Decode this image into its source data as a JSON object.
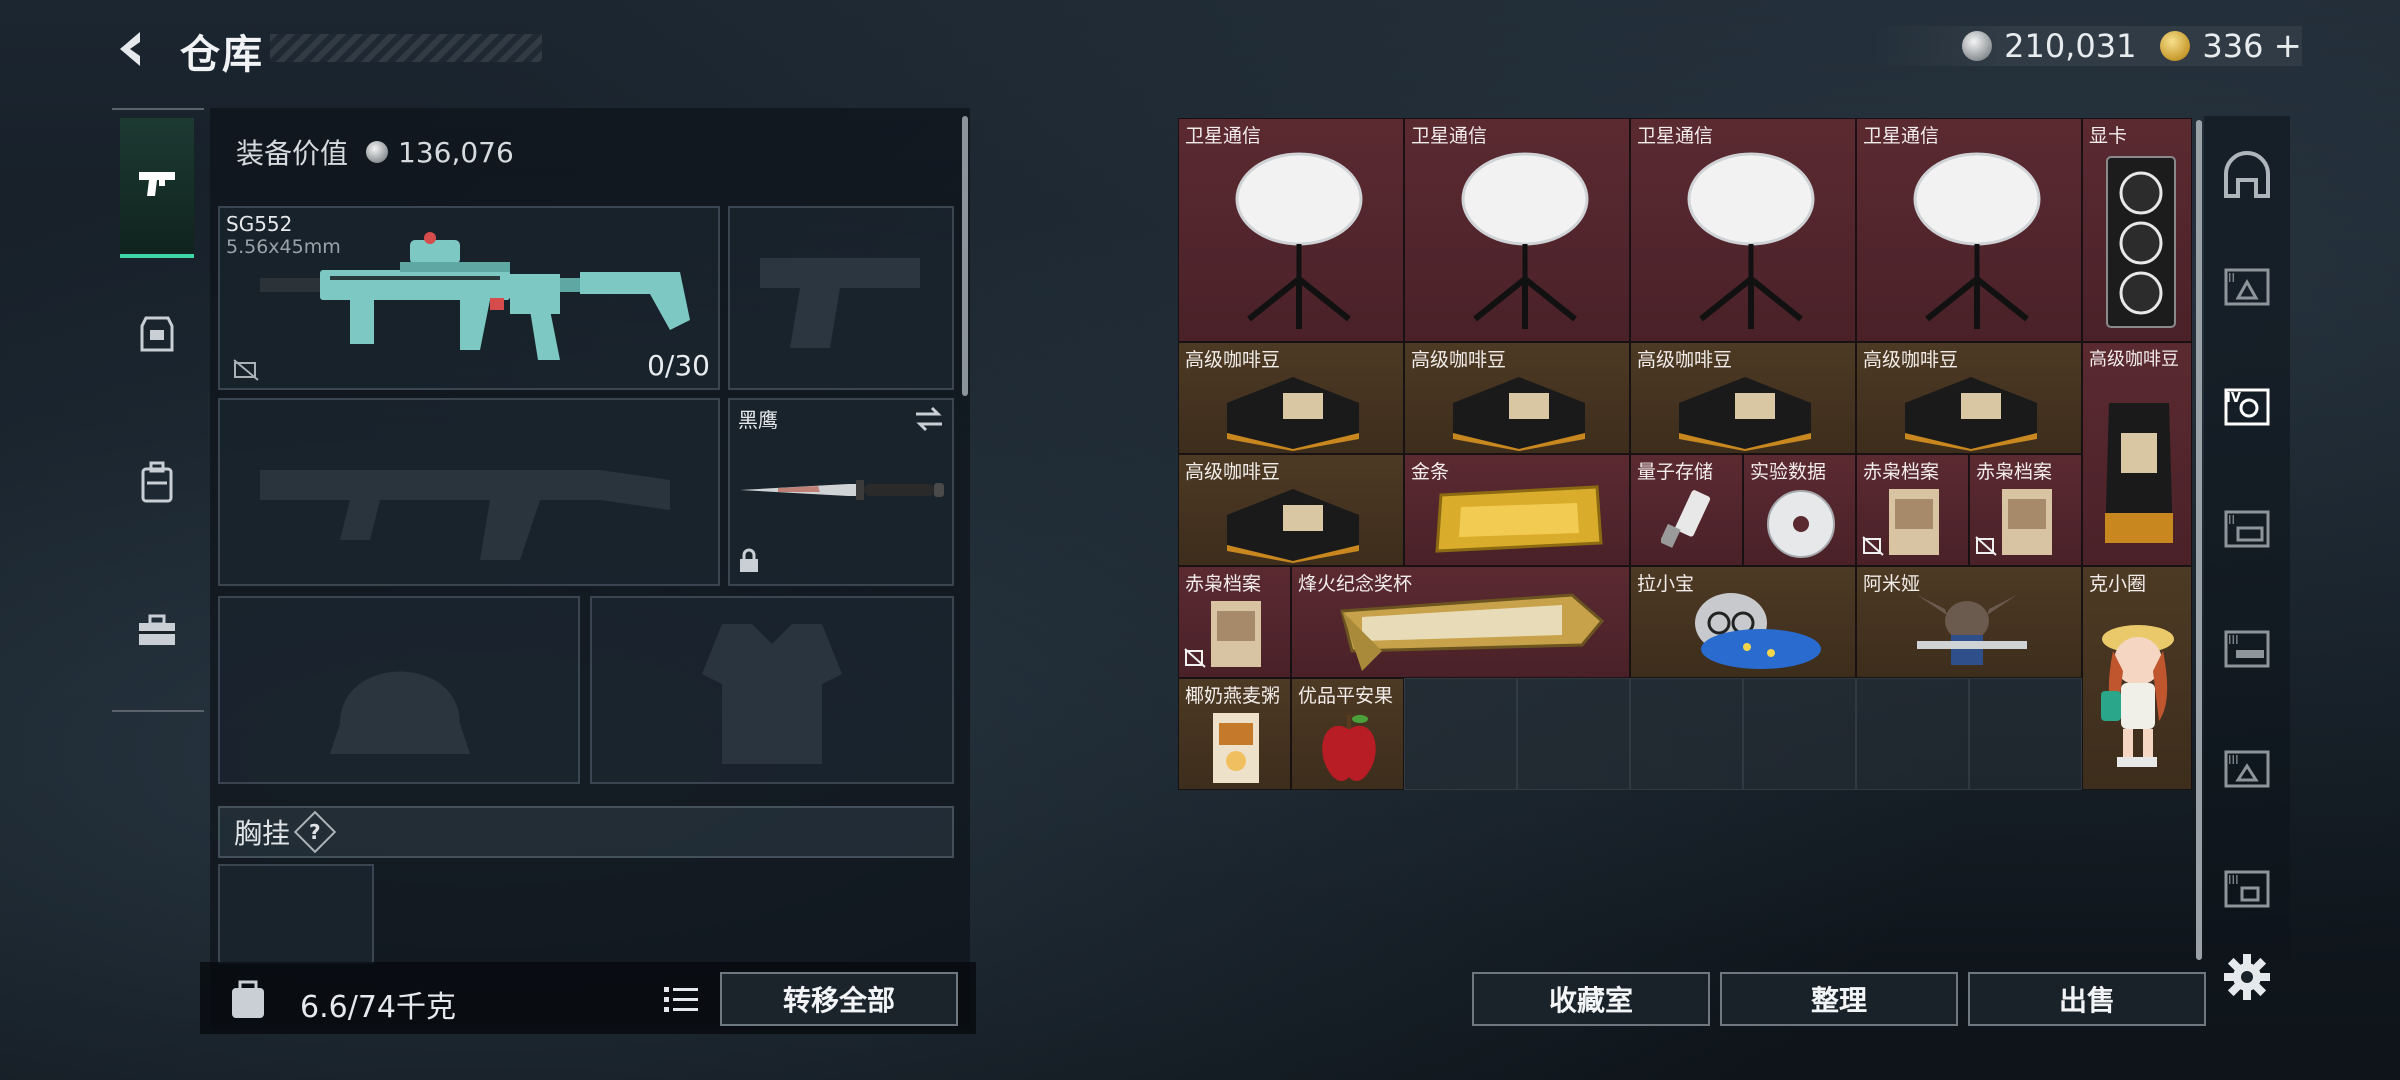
{
  "header": {
    "title": "仓库"
  },
  "currency": {
    "silver": "210,031",
    "gold": "336"
  },
  "loadout": {
    "equip_value_label": "装备价值",
    "equip_value": "136,076",
    "primary": {
      "name": "SG552",
      "caliber": "5.56x45mm",
      "ammo": "0/30"
    },
    "melee": {
      "name": "黑鹰"
    },
    "chest_rig_label": "胸挂",
    "weight": "6.6/74千克",
    "transfer_all": "转移全部"
  },
  "stash": {
    "items": [
      "卫星通信",
      "卫星通信",
      "卫星通信",
      "卫星通信",
      "显卡",
      "高级咖啡豆",
      "高级咖啡豆",
      "高级咖啡豆",
      "高级咖啡豆",
      "高级咖啡豆",
      "高级咖啡豆",
      "金条",
      "量子存储",
      "实验数据",
      "赤枭档案",
      "赤枭档案",
      "赤枭档案",
      "烽火纪念奖杯",
      "拉小宝",
      "阿米娅",
      "克小圈",
      "椰奶燕麦粥",
      "优品平安果"
    ]
  },
  "actions": {
    "collection": "收藏室",
    "organize": "整理",
    "sell": "出售"
  },
  "icons": [
    "back-arrow-icon",
    "silver-coin-icon",
    "gold-coin-icon",
    "pistol-icon",
    "armor-icon",
    "backpack-icon",
    "toolbox-icon",
    "settings-icon",
    "list-icon",
    "lock-icon",
    "swap-icon",
    "bag-icon"
  ],
  "colors": {
    "accent": "#3ed6a6",
    "rare_red": "#5b2a31",
    "legendary_gold": "#4d3a24",
    "weapon_teal": "#7ec8c3"
  }
}
